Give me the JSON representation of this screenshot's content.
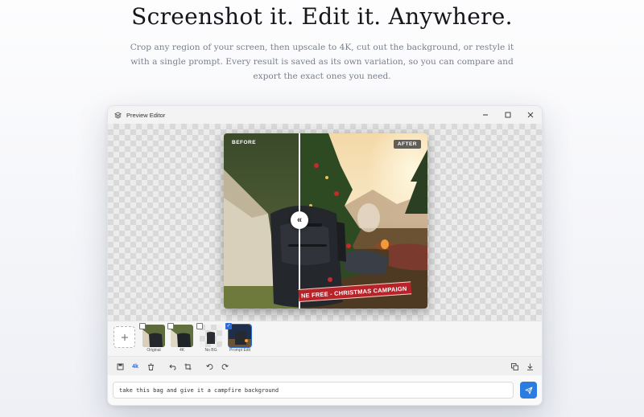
{
  "hero": {
    "title": "Screenshot it. Edit it. Anywhere.",
    "subtitle": "Crop any region of your screen, then upscale to 4K, cut out the background, or restyle it with a single prompt. Every result is saved as its own variation, so you can compare and export the exact ones you need."
  },
  "window": {
    "title": "Preview Editor",
    "controls": [
      "minimize",
      "maximize",
      "close"
    ]
  },
  "compare": {
    "before_label": "BEFORE",
    "after_label": "AFTER",
    "banner_text": "NE FREE - CHRISTMAS CAMPAIGN",
    "handle_icon": "double-chevron-left-icon"
  },
  "variations": {
    "add_icon": "plus-icon",
    "items": [
      {
        "label": "Original",
        "checked": false
      },
      {
        "label": "4K",
        "checked": false
      },
      {
        "label": "No BG",
        "checked": false
      },
      {
        "label": "Prompt Edit",
        "checked": true
      }
    ]
  },
  "toolbar": {
    "upscale_label": "4k",
    "icons": [
      "save-icon",
      "4k-icon",
      "trash-icon",
      "undo-icon",
      "crop-icon",
      "rotate-left-icon",
      "rotate-right-icon",
      "copy-icon",
      "download-icon"
    ]
  },
  "prompt": {
    "value": "take this bag and give it a campfire background"
  },
  "colors": {
    "accent": "#2b7ce0",
    "banner": "#b8232a"
  }
}
